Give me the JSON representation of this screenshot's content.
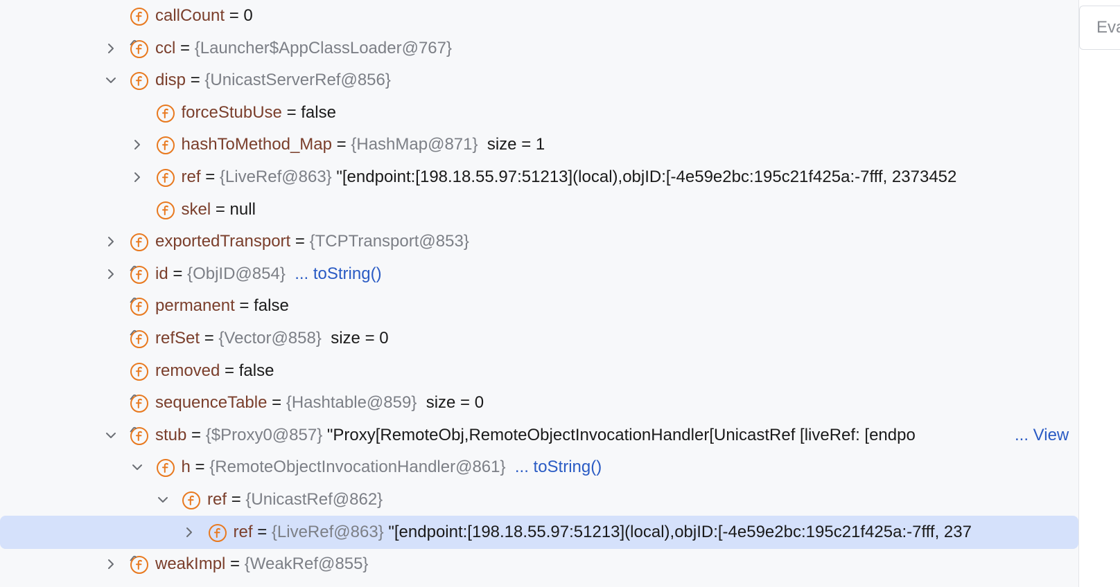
{
  "tree": {
    "rows": [
      {
        "depth": 0,
        "arrow": "none",
        "icon": "field-icon",
        "name": "callCount",
        "type": "",
        "value": "0",
        "link": ""
      },
      {
        "depth": 0,
        "arrow": "collapsed",
        "icon": "field-link-icon",
        "name": "ccl",
        "type": "{Launcher$AppClassLoader@767}",
        "value": "",
        "link": ""
      },
      {
        "depth": 0,
        "arrow": "expanded",
        "icon": "field-icon",
        "name": "disp",
        "type": "{UnicastServerRef@856}",
        "value": "",
        "link": ""
      },
      {
        "depth": 1,
        "arrow": "none",
        "icon": "field-icon",
        "name": "forceStubUse",
        "type": "",
        "value": "false",
        "link": ""
      },
      {
        "depth": 1,
        "arrow": "collapsed",
        "icon": "field-icon",
        "name": "hashToMethod_Map",
        "type": "{HashMap@871}",
        "value": "size = 1",
        "link": ""
      },
      {
        "depth": 1,
        "arrow": "collapsed",
        "icon": "field-icon",
        "name": "ref",
        "type": "{LiveRef@863}",
        "value": "\"[endpoint:[198.18.55.97:51213](local),objID:[-4e59e2bc:195c21f425a:-7fff, 2373452",
        "link": ""
      },
      {
        "depth": 1,
        "arrow": "none",
        "icon": "field-icon",
        "name": "skel",
        "type": "",
        "value": "null",
        "link": ""
      },
      {
        "depth": 0,
        "arrow": "collapsed",
        "icon": "field-icon",
        "name": "exportedTransport",
        "type": "{TCPTransport@853}",
        "value": "",
        "link": ""
      },
      {
        "depth": 0,
        "arrow": "collapsed",
        "icon": "field-link-icon",
        "name": "id",
        "type": "{ObjID@854}",
        "value": "",
        "link": "... toString()"
      },
      {
        "depth": 0,
        "arrow": "none",
        "icon": "field-link-icon",
        "name": "permanent",
        "type": "",
        "value": "false",
        "link": ""
      },
      {
        "depth": 0,
        "arrow": "none",
        "icon": "field-link-icon",
        "name": "refSet",
        "type": "{Vector@858}",
        "value": "size = 0",
        "link": ""
      },
      {
        "depth": 0,
        "arrow": "none",
        "icon": "field-icon",
        "name": "removed",
        "type": "",
        "value": "false",
        "link": ""
      },
      {
        "depth": 0,
        "arrow": "none",
        "icon": "field-link-icon",
        "name": "sequenceTable",
        "type": "{Hashtable@859}",
        "value": "size = 0",
        "link": ""
      },
      {
        "depth": 0,
        "arrow": "expanded",
        "icon": "field-link-icon",
        "name": "stub",
        "type": "{$Proxy0@857}",
        "value": "\"Proxy[RemoteObj,RemoteObjectInvocationHandler[UnicastRef [liveRef: [endpo",
        "link": "",
        "right_link": "... View"
      },
      {
        "depth": 1,
        "arrow": "expanded",
        "icon": "field-icon",
        "name": "h",
        "type": "{RemoteObjectInvocationHandler@861}",
        "value": "",
        "link": "... toString()"
      },
      {
        "depth": 2,
        "arrow": "expanded",
        "icon": "field-icon",
        "name": "ref",
        "type": "{UnicastRef@862}",
        "value": "",
        "link": ""
      },
      {
        "depth": 3,
        "arrow": "collapsed",
        "icon": "field-icon",
        "name": "ref",
        "type": "{LiveRef@863}",
        "value": "\"[endpoint:[198.18.55.97:51213](local),objID:[-4e59e2bc:195c21f425a:-7fff, 237",
        "link": "",
        "selected": true
      },
      {
        "depth": 0,
        "arrow": "collapsed",
        "icon": "field-link-icon",
        "name": "weakImpl",
        "type": "{WeakRef@855}",
        "value": "",
        "link": ""
      }
    ],
    "equals": "="
  },
  "evaluate": {
    "label": "Eva"
  },
  "colors": {
    "field_icon": "#e8791f",
    "name": "#7a3e2b",
    "type": "#7c7f86",
    "link": "#2a5bc4",
    "selection": "#d5e1fb"
  }
}
